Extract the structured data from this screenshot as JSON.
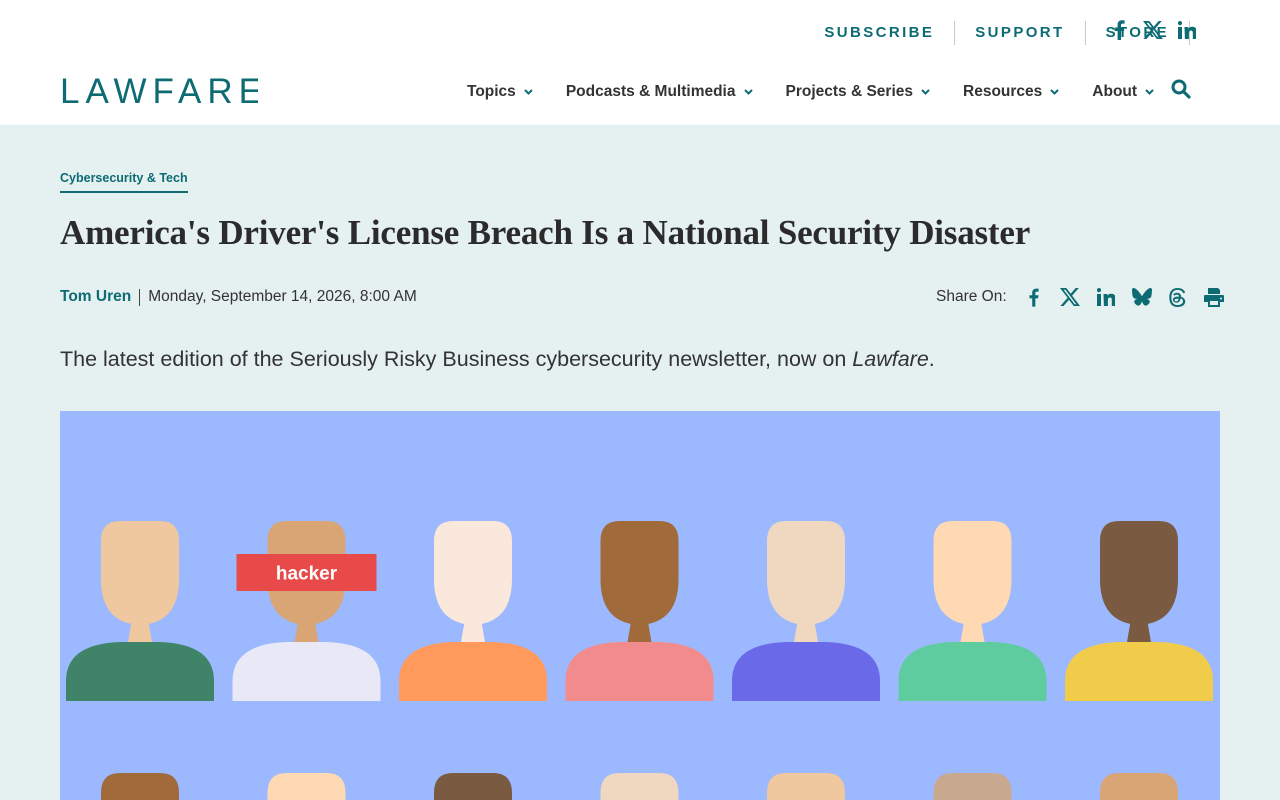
{
  "site": {
    "logo_text": "LAWFARE",
    "brand_color": "#0d6b73"
  },
  "utility_nav": {
    "subscribe": "SUBSCRIBE",
    "support": "SUPPORT",
    "store": "STORE",
    "social": [
      "facebook-icon",
      "x-icon",
      "linkedin-icon"
    ]
  },
  "main_nav": {
    "items": [
      {
        "label": "Topics"
      },
      {
        "label": "Podcasts & Multimedia"
      },
      {
        "label": "Projects & Series"
      },
      {
        "label": "Resources"
      },
      {
        "label": "About"
      }
    ],
    "search_icon": "search-icon"
  },
  "article": {
    "category": "Cybersecurity & Tech",
    "title": "America's Driver's License Breach Is a National Security Disaster",
    "author": "Tom Uren",
    "date": "Monday, September 14, 2026, 8:00 AM",
    "share_label": "Share On:",
    "share_icons": [
      "facebook-icon",
      "x-icon",
      "linkedin-icon",
      "bluesky-icon",
      "threads-icon",
      "print-icon"
    ],
    "dek_text": "The latest edition of the Seriously Risky Business cybersecurity newsletter, now on ",
    "dek_italic": "Lawfare",
    "dek_end": "."
  },
  "hero": {
    "background": "#9cb8ff",
    "label": "hacker",
    "label_color": "#e84a4a",
    "row1": [
      {
        "skin": "#f0c8a0",
        "shirt": "#3f8468"
      },
      {
        "skin": "#d9a574",
        "shirt": "#e8e8f6",
        "tagged": true
      },
      {
        "skin": "#fae8dc",
        "shirt": "#ff9a5c"
      },
      {
        "skin": "#a06a3a",
        "shirt": "#f28c8c"
      },
      {
        "skin": "#f0d8c0",
        "shirt": "#6a6ae8"
      },
      {
        "skin": "#ffd8b4",
        "shirt": "#5ecc9e"
      },
      {
        "skin": "#7a5a40",
        "shirt": "#f0cc4a"
      }
    ],
    "row2": [
      "#a06a3a",
      "#ffd8b4",
      "#7a5a40",
      "#f0d8c0",
      "#f0c8a0",
      "#c9a890",
      "#d9a574"
    ]
  }
}
